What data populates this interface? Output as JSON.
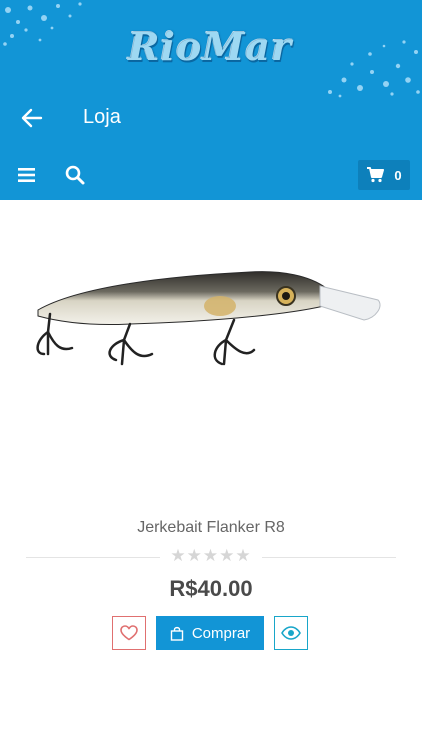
{
  "header": {
    "logo_text": "RioMar",
    "title": "Loja",
    "cart_count": "0"
  },
  "icons": {
    "back": "arrow-left-icon",
    "menu": "hamburger-menu-icon",
    "search": "search-icon",
    "cart": "shopping-cart-icon",
    "wishlist": "heart-icon",
    "buy": "shopping-bag-icon",
    "view": "eye-icon"
  },
  "product": {
    "name": "Jerkebait Flanker R8",
    "rating_stars": "★★★★★",
    "rating_value": 0,
    "price": "R$40.00",
    "buy_label": "Comprar"
  },
  "colors": {
    "brand_blue": "#1295d6",
    "wishlist_red": "#e07070",
    "view_teal": "#18a6c9"
  }
}
